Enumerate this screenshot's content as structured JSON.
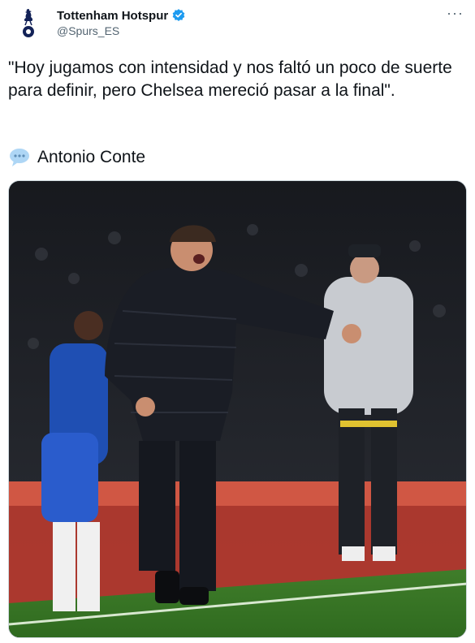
{
  "author": {
    "display_name": "Tottenham Hotspur",
    "handle": "@Spurs_ES",
    "avatar_icon": "spurs-cockerel-logo",
    "verified_icon": "verified-badge-icon"
  },
  "menu_icon": "more-options-icon",
  "tweet": {
    "text": "\"Hoy jugamos con intensidad y nos faltó un poco de suerte para definir, pero Chelsea mereció pasar a la final\".",
    "speech_icon": "speech-balloon-icon",
    "attribution": "Antonio Conte"
  },
  "media": {
    "type": "photo"
  },
  "colors": {
    "text": "#0f1419",
    "secondary": "#536471",
    "verified": "#1d9bf0"
  }
}
